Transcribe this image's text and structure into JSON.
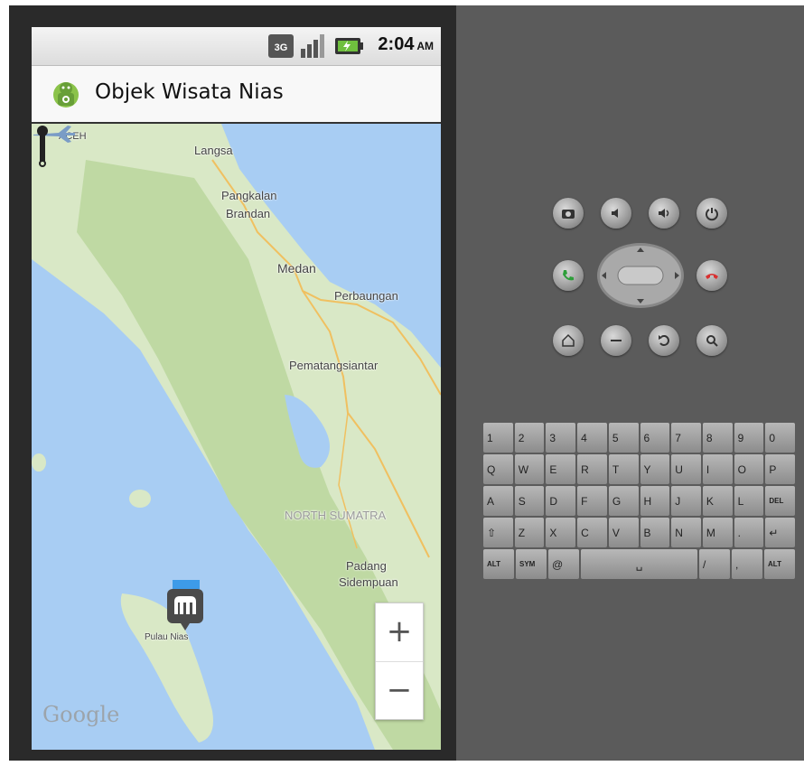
{
  "statusbar": {
    "time": "2:04",
    "ampm": "AM"
  },
  "app": {
    "title": "Objek Wisata Nias"
  },
  "map": {
    "labels": {
      "aceh": "ACEH",
      "langsa": "Langsa",
      "pangkalan": "Pangkalan",
      "brandan": "Brandan",
      "medan": "Medan",
      "perbaungan": "Perbaungan",
      "pematang": "Pematangsiantar",
      "north_sumatra": "NORTH SUMATRA",
      "padang": "Padang",
      "sidempuan": "Sidempuan",
      "pulau_nias": "Pulau Nias"
    },
    "zoom_in": "+",
    "zoom_out": "−",
    "attribution": "Google"
  },
  "controls": {
    "keys_row1": [
      "1",
      "2",
      "3",
      "4",
      "5",
      "6",
      "7",
      "8",
      "9",
      "0"
    ],
    "keys_row2": [
      "Q",
      "W",
      "E",
      "R",
      "T",
      "Y",
      "U",
      "I",
      "O",
      "P"
    ],
    "keys_row3": [
      "A",
      "S",
      "D",
      "F",
      "G",
      "H",
      "J",
      "K",
      "L",
      "DEL"
    ],
    "keys_row4": [
      "⇧",
      "Z",
      "X",
      "C",
      "V",
      "B",
      "N",
      "M",
      ".",
      "↵"
    ],
    "key_alt": "ALT",
    "key_sym": "SYM",
    "key_at": "@",
    "key_space": "␣",
    "key_slash": "/",
    "key_comma": ",",
    "key_alt2": "ALT"
  }
}
